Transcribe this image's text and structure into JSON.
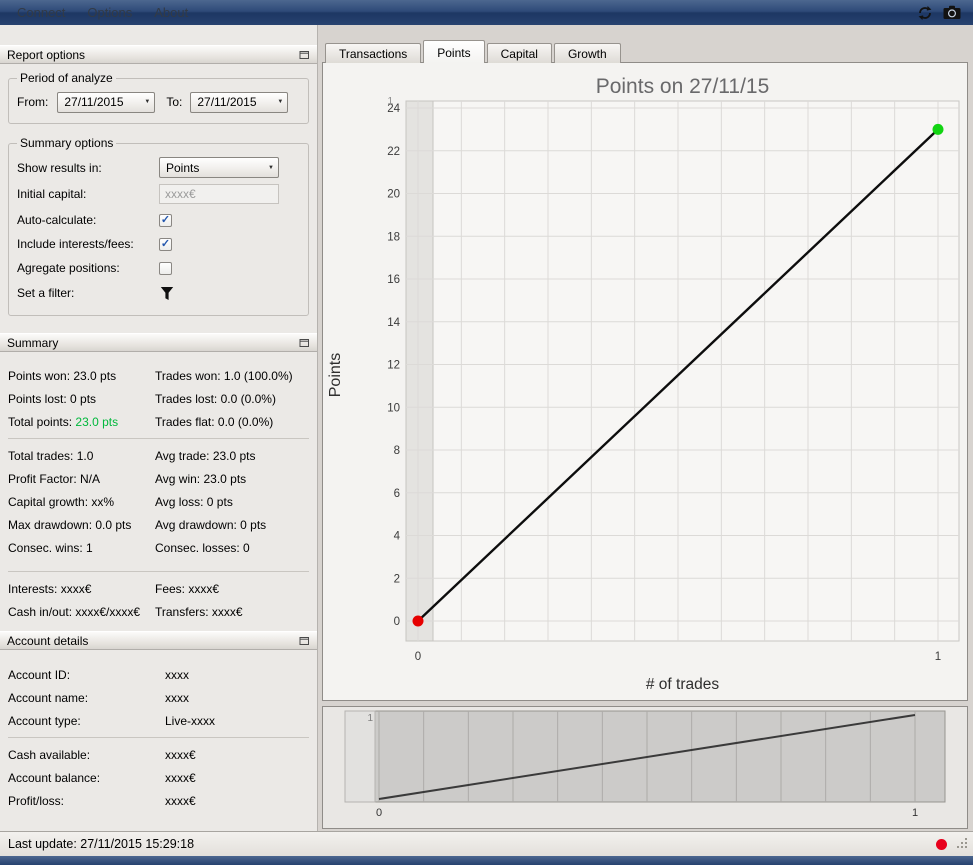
{
  "menu": {
    "items": [
      "Connect",
      "Options",
      "About"
    ]
  },
  "glyphs": {
    "combo_arrow": "▼",
    "check": "✓"
  },
  "colors": {
    "positive": "#00b83c",
    "status_dot": "#e8001c"
  },
  "report": {
    "title": "Report options",
    "period": {
      "legend": "Period of analyze",
      "from_label": "From:",
      "from_value": "27/11/2015",
      "to_label": "To:",
      "to_value": "27/11/2015"
    },
    "options": {
      "legend": "Summary options",
      "show_results_label": "Show results in:",
      "show_results_value": "Points",
      "initial_capital_label": "Initial capital:",
      "initial_capital_value": "xxxx€",
      "auto_calc_label": "Auto-calculate:",
      "auto_calc_checked": true,
      "include_fees_label": "Include interests/fees:",
      "include_fees_checked": true,
      "aggregate_label": "Agregate positions:",
      "aggregate_checked": false,
      "filter_label": "Set a filter:"
    }
  },
  "summary": {
    "title": "Summary",
    "total_points_color": "#00b83c",
    "group1": [
      {
        "left": "Points won: 23.0 pts",
        "right": "Trades won: 1.0 (100.0%)"
      },
      {
        "left": "Points lost: 0 pts",
        "right": "Trades lost: 0.0 (0.0%)"
      },
      {
        "left_label": "Total points:",
        "left_value": "23.0 pts",
        "right": "Trades flat: 0.0 (0.0%)"
      }
    ],
    "group2": [
      {
        "left": "Total trades: 1.0",
        "right": "Avg trade: 23.0 pts"
      },
      {
        "left": "Profit Factor: N/A",
        "right": "Avg win: 23.0 pts"
      },
      {
        "left": "Capital growth: xx%",
        "right": "Avg loss: 0 pts"
      },
      {
        "left": "Max drawdown: 0.0 pts",
        "right": "Avg drawdown: 0 pts"
      },
      {
        "left": "Consec. wins: 1",
        "right": "Consec. losses: 0"
      }
    ],
    "group3": [
      {
        "left": "Interests: xxxx€",
        "right": "Fees: xxxx€"
      },
      {
        "left": "Cash in/out: xxxx€/xxxx€",
        "right": "Transfers: xxxx€"
      }
    ]
  },
  "account": {
    "title": "Account details",
    "group1": [
      {
        "label": "Account ID:",
        "value": "xxxx"
      },
      {
        "label": "Account name:",
        "value": "xxxx"
      },
      {
        "label": "Account type:",
        "value": "Live-xxxx"
      }
    ],
    "group2": [
      {
        "label": "Cash available:",
        "value": "xxxx€"
      },
      {
        "label": "Account balance:",
        "value": "xxxx€"
      },
      {
        "label": "Profit/loss:",
        "value": "xxxx€"
      }
    ]
  },
  "tabs": [
    "Transactions",
    "Points",
    "Capital",
    "Growth"
  ],
  "active_tab": "Points",
  "statusbar": {
    "last_update": "Last update: 27/11/2015 15:29:18"
  },
  "chart_data": [
    {
      "type": "line",
      "title": "Points on 27/11/15",
      "xlabel": "# of trades",
      "ylabel": "Points",
      "x": [
        0,
        1
      ],
      "y": [
        0,
        23
      ],
      "xlim": [
        0,
        1
      ],
      "ylim": [
        0,
        24
      ],
      "xticks": [
        0,
        1
      ],
      "yticks": [
        0,
        2,
        4,
        6,
        8,
        10,
        12,
        14,
        16,
        18,
        20,
        22,
        24
      ],
      "grid": true,
      "x_grid_divisions": 12,
      "line_color": "#0d0d0d",
      "start_marker_color": "#e60000",
      "end_marker_color": "#12d412",
      "overlay_label": "1",
      "legend": "none"
    },
    {
      "type": "line",
      "role": "overview-selector",
      "x": [
        0,
        1
      ],
      "y": [
        0,
        23
      ],
      "xlim": [
        0,
        1
      ],
      "xticks": [
        0,
        1
      ],
      "x_grid_divisions": 12,
      "line_color": "#3a3a3a",
      "overlay_label": "1"
    }
  ]
}
